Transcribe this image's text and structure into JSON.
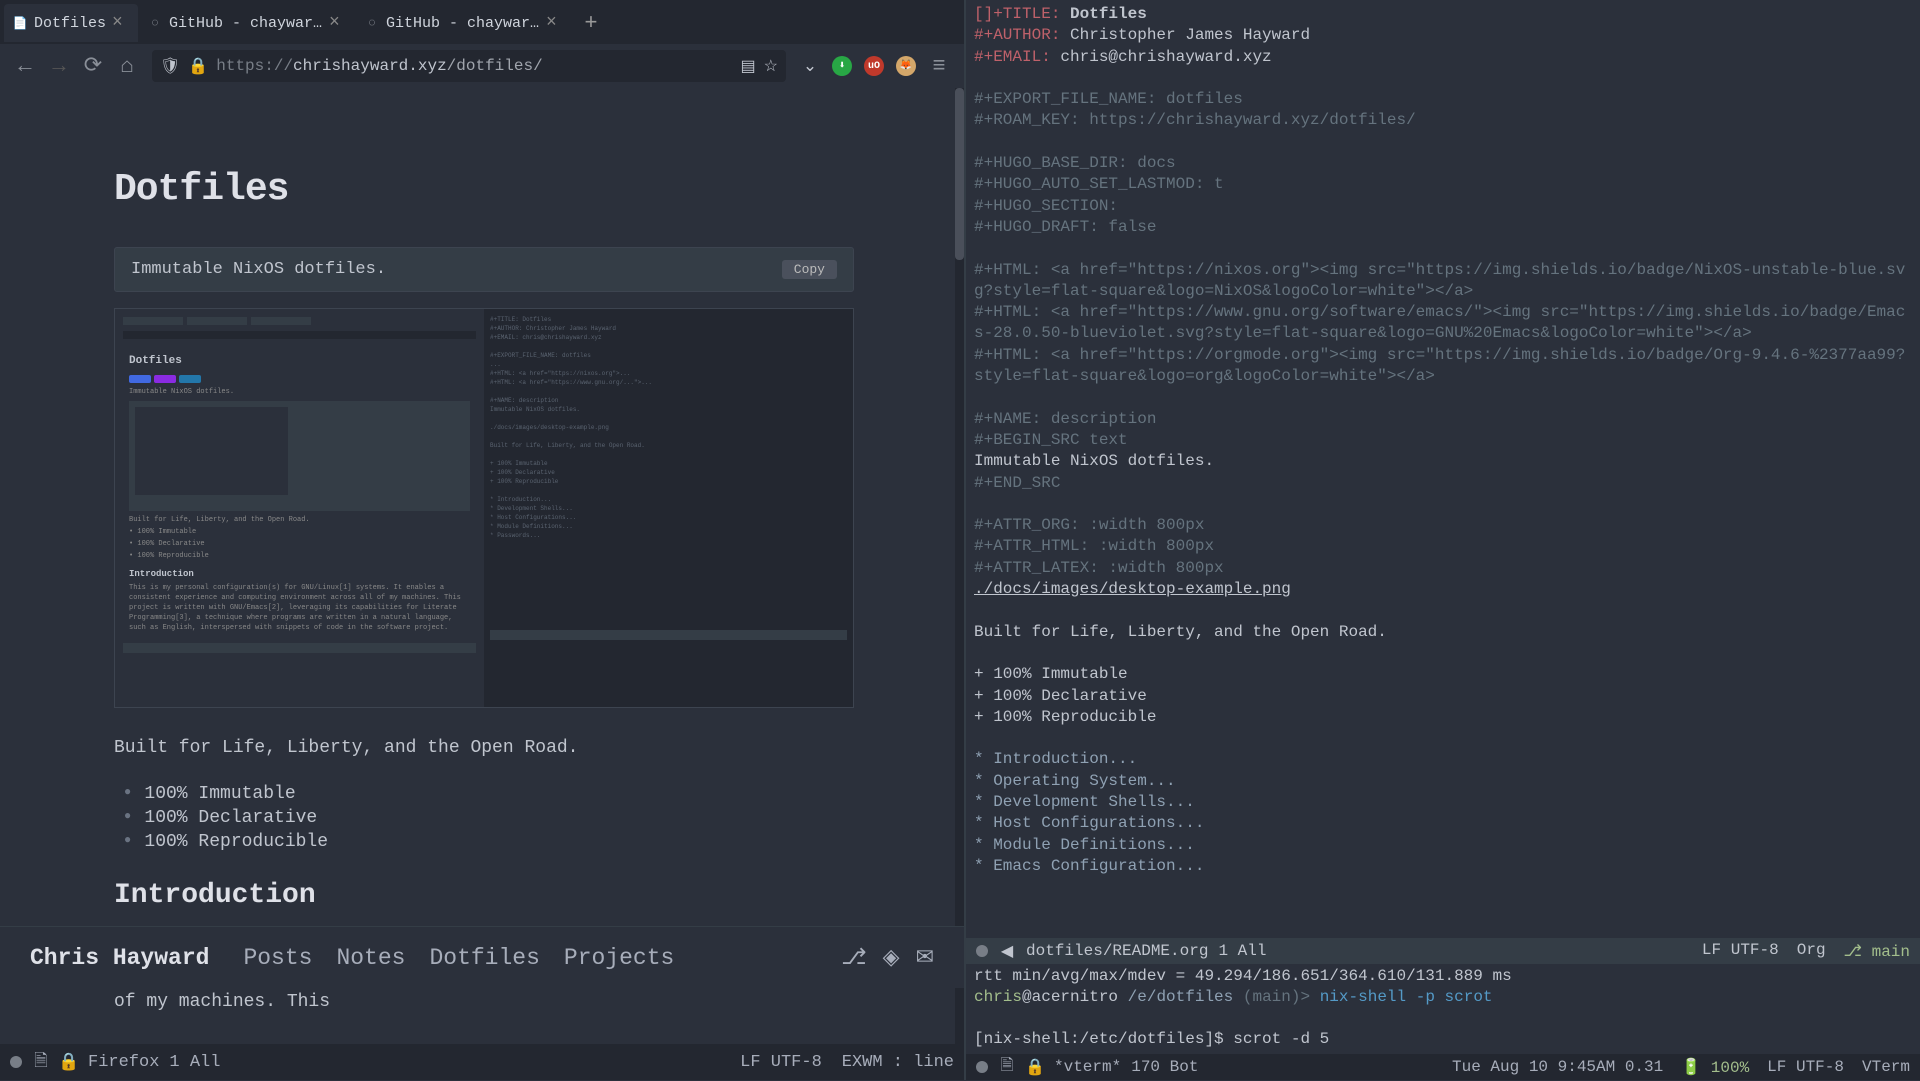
{
  "browser": {
    "tabs": [
      {
        "label": "Dotfiles",
        "active": true
      },
      {
        "label": "GitHub - chayward1/dotf",
        "active": false
      },
      {
        "label": "GitHub - chayward1/dotf",
        "active": false
      }
    ],
    "url_proto": "https://",
    "url_host": "chrishayward.xyz",
    "url_path": "/dotfiles/"
  },
  "page": {
    "title": "Dotfiles",
    "code_desc": "Immutable NixOS dotfiles.",
    "copy_btn": "Copy",
    "tagline": "Built for Life, Liberty, and the Open Road.",
    "bullets": [
      "100% Immutable",
      "100% Declarative",
      "100% Reproducible"
    ],
    "h2": "Introduction",
    "intro": "This is my personal configuration(s) for GNU/Linux",
    "intro_sup": "1",
    "intro_cont": " systems. It enables a consistent experience and computing environment across all of my machines. This"
  },
  "nested": {
    "h1": "Dotfiles",
    "desc": "Immutable NixOS dotfiles.",
    "tagline": "Built for Life, Liberty, and the Open Road.",
    "bullets": [
      "• 100% Immutable",
      "• 100% Declarative",
      "• 100% Reproducible"
    ],
    "intro": "Introduction",
    "intro_text": "This is my personal configuration(s) for GNU/Linux[1] systems. It enables a consistent experience and computing environment across all of my machines. This project is written with GNU/Emacs[2], leveraging its capabilities for Literate Programming[3], a technique where programs are written in a natural language, such as English, interspersed with snippets of code in the software project."
  },
  "footer": {
    "name": "Chris Hayward",
    "links": [
      "Posts",
      "Notes",
      "Dotfiles",
      "Projects"
    ]
  },
  "left_modeline": {
    "buffer": "Firefox",
    "pos": "1 All",
    "encoding": "LF UTF-8",
    "mode": "EXWM : line"
  },
  "emacs": {
    "lines": [
      {
        "raw": "[]+TITLE: ",
        "kw": true,
        "val": "Dotfiles",
        "bold": true
      },
      {
        "raw": "#+AUTHOR: ",
        "kw": true,
        "val": "Christopher James Hayward"
      },
      {
        "raw": "#+EMAIL: ",
        "kw": true,
        "val": "chris@chrishayward.xyz"
      },
      {
        "blank": true
      },
      {
        "gray": "#+EXPORT_FILE_NAME: dotfiles"
      },
      {
        "gray": "#+ROAM_KEY: https://chrishayward.xyz/dotfiles/"
      },
      {
        "blank": true
      },
      {
        "gray": "#+HUGO_BASE_DIR: docs"
      },
      {
        "gray": "#+HUGO_AUTO_SET_LASTMOD: t"
      },
      {
        "gray": "#+HUGO_SECTION:"
      },
      {
        "gray": "#+HUGO_DRAFT: false"
      },
      {
        "blank": true
      },
      {
        "gray": "#+HTML: <a href=\"https://nixos.org\"><img src=\"https://img.shields.io/badge/NixOS-unstable-blue.svg?style=flat-square&logo=NixOS&logoColor=white\"></a>"
      },
      {
        "gray": "#+HTML: <a href=\"https://www.gnu.org/software/emacs/\"><img src=\"https://img.shields.io/badge/Emacs-28.0.50-blueviolet.svg?style=flat-square&logo=GNU%20Emacs&logoColor=white\"></a>"
      },
      {
        "gray": "#+HTML: <a href=\"https://orgmode.org\"><img src=\"https://img.shields.io/badge/Org-9.4.6-%2377aa99?style=flat-square&logo=org&logoColor=white\"></a>"
      },
      {
        "blank": true
      },
      {
        "gray": "#+NAME: description"
      },
      {
        "gray": "#+BEGIN_SRC text"
      },
      {
        "src": "Immutable NixOS dotfiles."
      },
      {
        "gray": "#+END_SRC"
      },
      {
        "blank": true
      },
      {
        "gray": "#+ATTR_ORG: :width 800px"
      },
      {
        "gray": "#+ATTR_HTML: :width 800px"
      },
      {
        "gray": "#+ATTR_LATEX: :width 800px"
      },
      {
        "link": "./docs/images/desktop-example.png"
      },
      {
        "blank": true
      },
      {
        "src": "Built for Life, Liberty, and the Open Road."
      },
      {
        "blank": true
      },
      {
        "src": "+ 100% Immutable"
      },
      {
        "src": "+ 100% Declarative"
      },
      {
        "src": "+ 100% Reproducible"
      },
      {
        "blank": true
      },
      {
        "heading": "* Introduction..."
      },
      {
        "heading": "* Operating System..."
      },
      {
        "heading": "* Development Shells..."
      },
      {
        "heading": "* Host Configurations..."
      },
      {
        "heading": "* Module Definitions..."
      },
      {
        "heading": "* Emacs Configuration..."
      }
    ]
  },
  "emacs_modeline": {
    "path": "dotfiles/README.org",
    "pos": "1 All",
    "encoding": "LF UTF-8",
    "mode": "Org",
    "branch": "main"
  },
  "vterm": {
    "ping": "rtt min/avg/max/mdev = 49.294/186.651/364.610/131.889 ms",
    "user": "chris",
    "host": "@acernitro",
    "path": "/e/dotfiles",
    "branch": "(main)>",
    "cmd1": "nix-shell -p scrot",
    "prompt2": "[nix-shell:/etc/dotfiles]$",
    "cmd2": "scrot -d 5"
  },
  "vterm_modeline": {
    "buffer": "*vterm*",
    "pos": "170 Bot",
    "datetime": "Tue Aug 10 9:45AM 0.31",
    "battery": "100%",
    "encoding": "LF UTF-8",
    "mode": "VTerm"
  }
}
